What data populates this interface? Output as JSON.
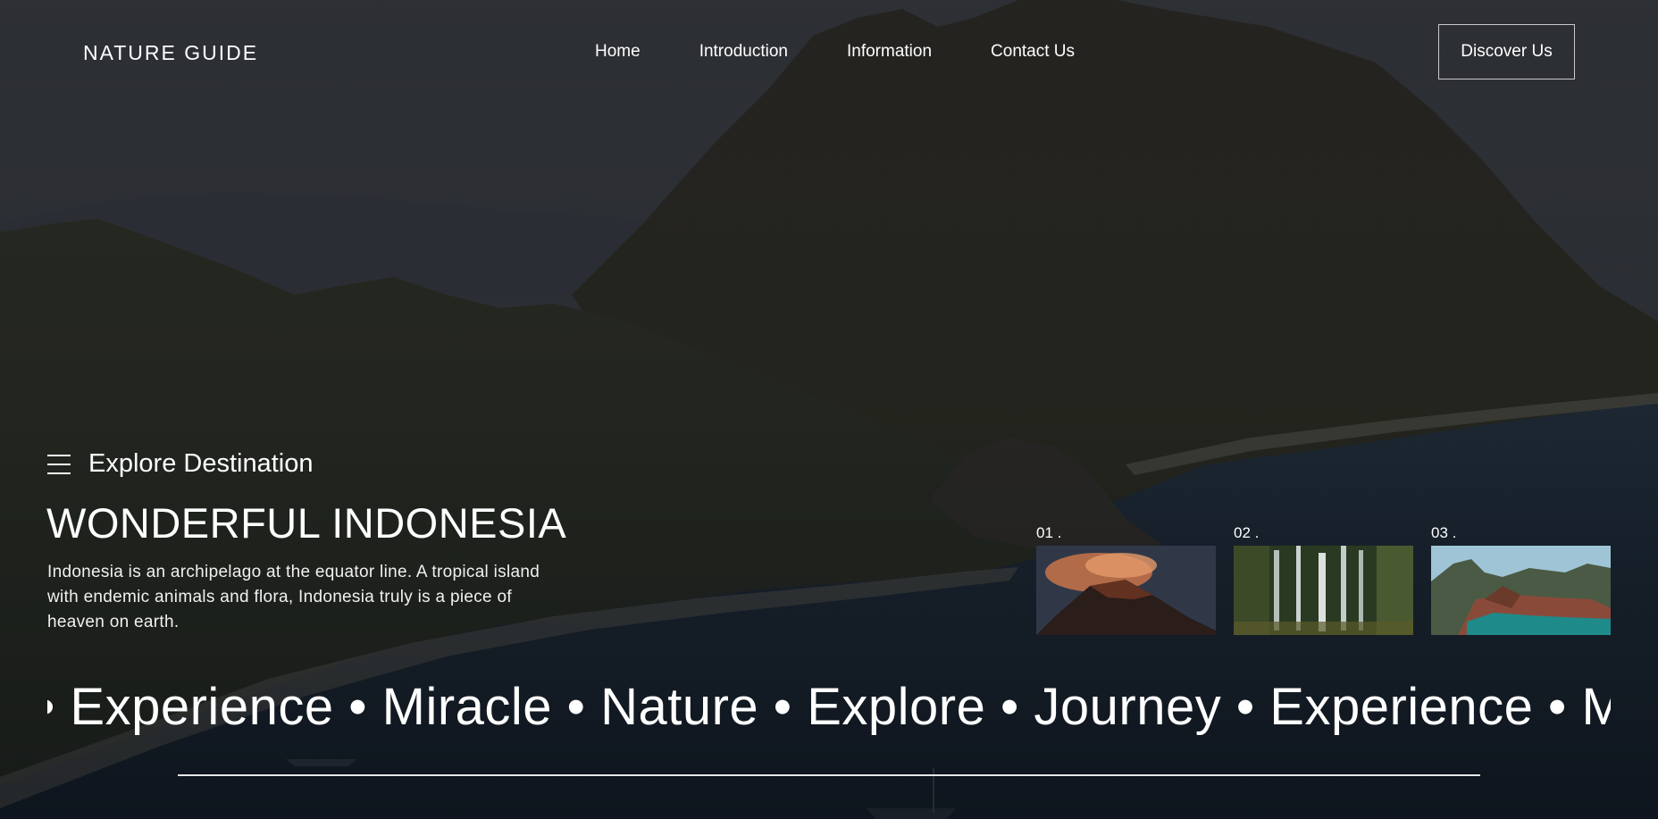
{
  "header": {
    "brand": "NATURE GUIDE",
    "nav": [
      "Home",
      "Introduction",
      "Information",
      "Contact Us"
    ],
    "cta_label": "Discover Us"
  },
  "hero": {
    "explore_label": "Explore Destination",
    "title": "WONDERFUL INDONESIA",
    "description": "Indonesia is an archipelago at the equator line. A tropical island with endemic animals and flora, Indonesia truly is a piece of heaven on earth."
  },
  "thumbnails": [
    {
      "number": "01 .",
      "icon": "volcano-image"
    },
    {
      "number": "02 .",
      "icon": "waterfall-image"
    },
    {
      "number": "03 .",
      "icon": "crater-lake-image"
    }
  ],
  "marquee": {
    "text": "• Experience • Miracle • Nature • Explore • Journey • Experience • M"
  },
  "colors": {
    "text": "#ffffff",
    "background": "#1d2126",
    "water": "#1b2a38"
  }
}
